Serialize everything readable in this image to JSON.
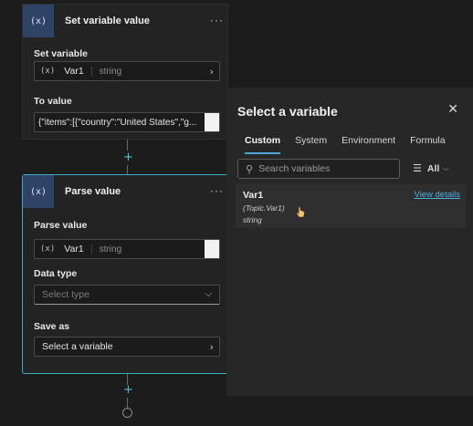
{
  "set_variable_node": {
    "title": "Set variable value",
    "icon": "(x)",
    "menu": "···",
    "set_variable_label": "Set variable",
    "variable": {
      "icon": "(x)",
      "name": "Var1",
      "type": "string"
    },
    "to_value_label": "To value",
    "to_value": "{\"items\":[{\"country\":\"United States\",\"g..."
  },
  "parse_value_node": {
    "title": "Parse value",
    "icon": "(x)",
    "menu": "···",
    "parse_value_label": "Parse value",
    "variable": {
      "icon": "(x)",
      "name": "Var1",
      "type": "string"
    },
    "data_type_label": "Data type",
    "data_type_placeholder": "Select type",
    "save_as_label": "Save as",
    "save_as_value": "Select a variable"
  },
  "connectors": {
    "add_symbol": "+"
  },
  "panel": {
    "title": "Select a variable",
    "close": "✕",
    "tabs": [
      {
        "label": "Custom",
        "active": true
      },
      {
        "label": "System",
        "active": false
      },
      {
        "label": "Environment",
        "active": false
      },
      {
        "label": "Formula",
        "active": false
      }
    ],
    "search_placeholder": "Search variables",
    "filter_label": "All",
    "variables": [
      {
        "name": "Var1",
        "path": "(Topic.Var1)",
        "type": "string",
        "link": "View details"
      }
    ]
  },
  "colors": {
    "accent": "#3ab0c8",
    "icon_bg": "#2f4366",
    "tab_underline": "#4aa8d8",
    "link": "#4cb0e0"
  },
  "icons": {
    "variable": "variable-icon",
    "menu": "more-icon",
    "chevron": "chevron-right-icon",
    "search": "search-icon",
    "filter": "filter-icon",
    "close": "close-icon"
  }
}
